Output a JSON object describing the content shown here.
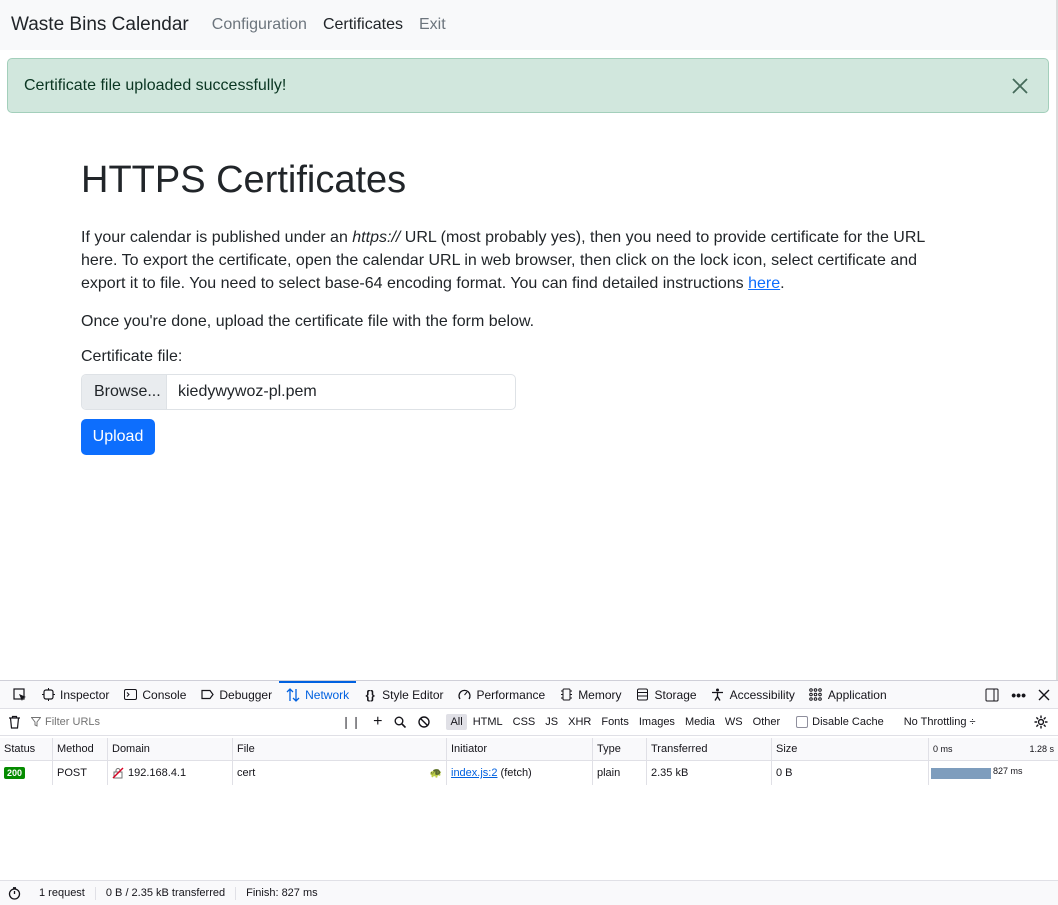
{
  "navbar": {
    "brand": "Waste Bins Calendar",
    "links": [
      "Configuration",
      "Certificates",
      "Exit"
    ],
    "active_index": 1
  },
  "alert": {
    "message": "Certificate file uploaded successfully!",
    "color": "#d1e7dd"
  },
  "main": {
    "title": "HTTPS Certificates",
    "para1_a": "If your calendar is published under an ",
    "para1_em": "https://",
    "para1_b": " URL (most probably yes), then you need to provide certificate for the URL here. To export the certificate, open the calendar URL in web browser, then click on the lock icon, select certificate and export it to file. You need to select base-64 encoding format. You can find detailed instructions ",
    "para1_link": "here",
    "para1_end": ".",
    "para2": "Once you're done, upload the certificate file with the form below.",
    "file_label": "Certificate file:",
    "browse_label": "Browse...",
    "file_value": "kiedywywoz-pl.pem",
    "upload_label": "Upload",
    "accent_color": "#0d6efd"
  },
  "devtools": {
    "tabs": [
      "Inspector",
      "Console",
      "Debugger",
      "Network",
      "Style Editor",
      "Performance",
      "Memory",
      "Storage",
      "Accessibility",
      "Application"
    ],
    "active_tab": "Network",
    "filter_placeholder": "Filter URLs",
    "type_filters": [
      "All",
      "HTML",
      "CSS",
      "JS",
      "XHR",
      "Fonts",
      "Images",
      "Media",
      "WS",
      "Other"
    ],
    "disable_cache_label": "Disable Cache",
    "throttling_label": "No Throttling ÷",
    "columns": [
      "Status",
      "Method",
      "Domain",
      "File",
      "Initiator",
      "Type",
      "Transferred",
      "Size",
      "0 ms",
      "1.28 s"
    ],
    "requests": [
      {
        "status": "200",
        "method": "POST",
        "domain": "192.168.4.1",
        "file": "cert",
        "initiator_link": "index.js:2",
        "initiator_note": "(fetch)",
        "type": "plain",
        "transferred": "2.35 kB",
        "size": "0 B",
        "timing": "827 ms"
      }
    ],
    "statusbar": {
      "requests": "1 request",
      "transferred": "0 B / 2.35 kB transferred",
      "finish": "Finish: 827 ms"
    }
  }
}
